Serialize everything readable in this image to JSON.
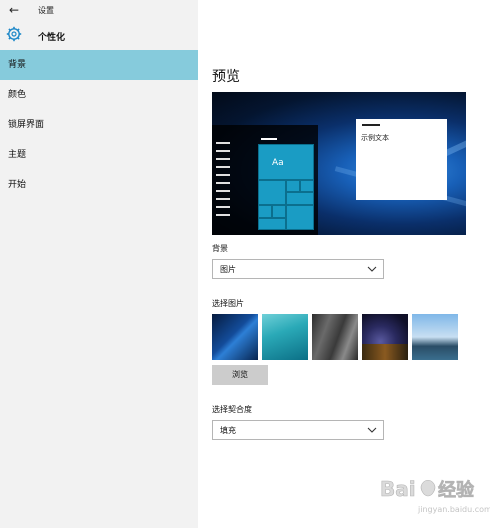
{
  "titlebar": {
    "back_icon": "back-arrow-icon",
    "title": "设置"
  },
  "section": {
    "icon": "gear-icon",
    "title": "个性化"
  },
  "nav": {
    "items": [
      {
        "label": "背景",
        "active": true
      },
      {
        "label": "颜色",
        "active": false
      },
      {
        "label": "锁屏界面",
        "active": false
      },
      {
        "label": "主题",
        "active": false
      },
      {
        "label": "开始",
        "active": false
      }
    ]
  },
  "main": {
    "page_title": "预览",
    "preview": {
      "sample_text": "示例文本",
      "tile_label": "Aa"
    },
    "background_label": "背景",
    "background_value": "图片",
    "choose_picture_label": "选择图片",
    "browse_label": "浏览",
    "fit_label": "选择契合度",
    "fit_value": "填充"
  },
  "colors": {
    "accent": "#86cbdc",
    "tile": "#1a9cc4",
    "sidebar_bg": "#f2f2f2"
  },
  "watermark": {
    "text": "Baidu经验",
    "url": "jingyan.baidu.com"
  }
}
